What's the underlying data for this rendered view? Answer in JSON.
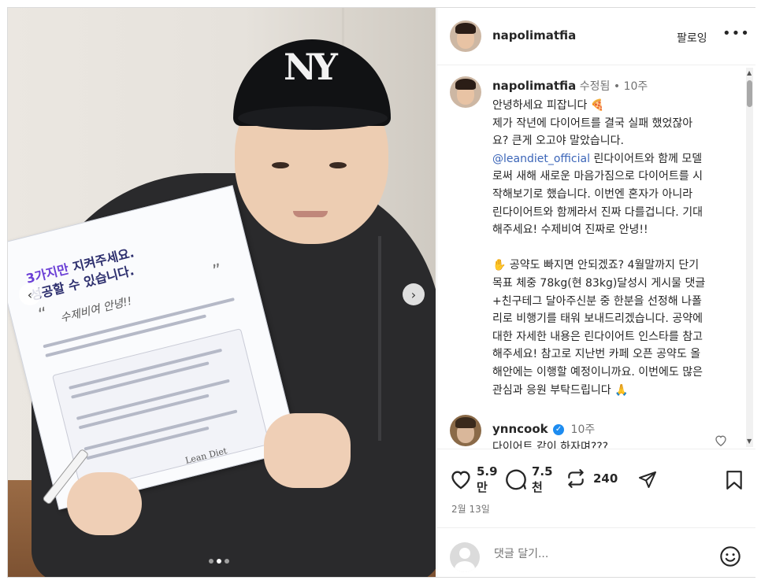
{
  "post": {
    "username": "napolimatfia",
    "follow_label": "팔로잉",
    "more_label": "•••",
    "meta_edited": "수정됨",
    "meta_sep": "•",
    "meta_age": "10주",
    "caption_lines": [
      "안녕하세요 피잡니다 🍕",
      "제가 작년에 다이어트를 결국 실패 했었잖아",
      "요? 큰게 오고야 말았습니다.",
      "@leandiet_official 린다이어트와 함께 모델",
      "로써 새해 새로운 마음가짐으로 다이어트를 시",
      "작해보기로 했습니다. 이번엔 혼자가 아니라",
      "린다이어트와 함께라서 진짜 다를겁니다. 기대",
      "해주세요! 수제비여 진짜로 안녕!!",
      "",
      "✋ 공약도 빠지면 안되겠죠? 4월말까지 단기",
      "목표 체중 78kg(현 83kg)달성시 게시물 댓글",
      "+친구테그 달아주신분 중 한분을 선정해 나폴",
      "리로 비행기를 태워 보내드리겠습니다. 공약에",
      "대한 자세한 내용은 린다이어트 인스타를 참고",
      "해주세요! 참고로 지난번 카페 오픈 공약도 올",
      "해안에는 이행할 예정이니까요. 이번에도 많은",
      "관심과 응원 부탁드립니다 🙏"
    ],
    "mention": "@leandiet_official"
  },
  "comment": {
    "username": "ynncook",
    "verified_mark": "✓",
    "age": "10주",
    "text": "다이어트 같이 하자며???"
  },
  "actions": {
    "likes": "5.9\n만",
    "comments": "7.5\n천",
    "reposts": "240",
    "date": "2월 13일"
  },
  "reply": {
    "placeholder": "댓글 달기..."
  },
  "image": {
    "paper_title_accent": "3가지만",
    "paper_title_rest": " 지켜주세요.",
    "paper_title_2": "성공할 수 있습니다.",
    "paper_signature": "수제비여   안녕!!",
    "paper_brand": "Lean Diet",
    "cap_logo": "NY",
    "carousel_total": 3,
    "carousel_active": 2
  },
  "icons": {
    "heart": "heart-icon",
    "comment": "comment-icon",
    "repost": "repost-icon",
    "share": "share-icon",
    "save": "bookmark-icon",
    "emoji": "emoji-icon"
  },
  "colors": {
    "mention": "#3b65b8",
    "verified": "#1d8cf0",
    "muted": "#737373"
  }
}
